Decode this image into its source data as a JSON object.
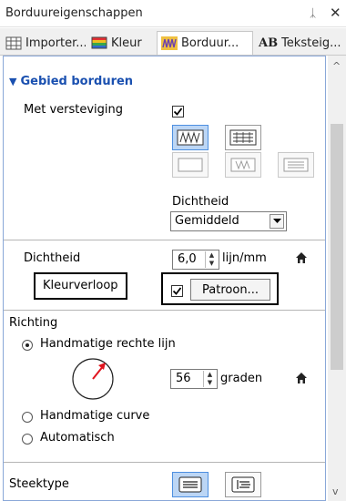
{
  "titlebar": {
    "title": "Borduureigenschappen",
    "pin_glyph": "ᛣ",
    "close_glyph": "✕"
  },
  "tabs": [
    {
      "label": "Importer...",
      "icon": "import-grid-icon",
      "active": false
    },
    {
      "label": "Kleur",
      "icon": "color-palette-icon",
      "active": false
    },
    {
      "label": "Borduur...",
      "icon": "embroidery-stitch-icon",
      "active": true
    },
    {
      "label": "Teksteig...",
      "icon": "text-ab-icon",
      "icon_text": "AB",
      "active": false
    }
  ],
  "section": {
    "arrow_glyph": "▼",
    "title": "Gebied borduren"
  },
  "reinforce": {
    "label": "Met versteviging",
    "checked": true
  },
  "fill_pattern": {
    "label": "Dichtheid",
    "selected": "Gemiddeld"
  },
  "density": {
    "label": "Dichtheid",
    "value": "6,0",
    "unit": "lijn/mm"
  },
  "gradient": {
    "label": "Kleurverloop",
    "checked": true,
    "button_label": "Patroon..."
  },
  "direction": {
    "label": "Richting",
    "options": [
      "Handmatige rechte lijn",
      "Handmatige curve",
      "Automatisch"
    ],
    "selected_index": 0,
    "angle_value": "56",
    "angle_unit": "graden"
  },
  "stitch_type": {
    "label": "Steektype"
  },
  "colors": {
    "accent": "#1a50b0",
    "selected_bg": "#bcd6f5",
    "needle_red": "#e0141e"
  },
  "scroll": {
    "up_glyph": "^",
    "down_glyph": "v"
  }
}
